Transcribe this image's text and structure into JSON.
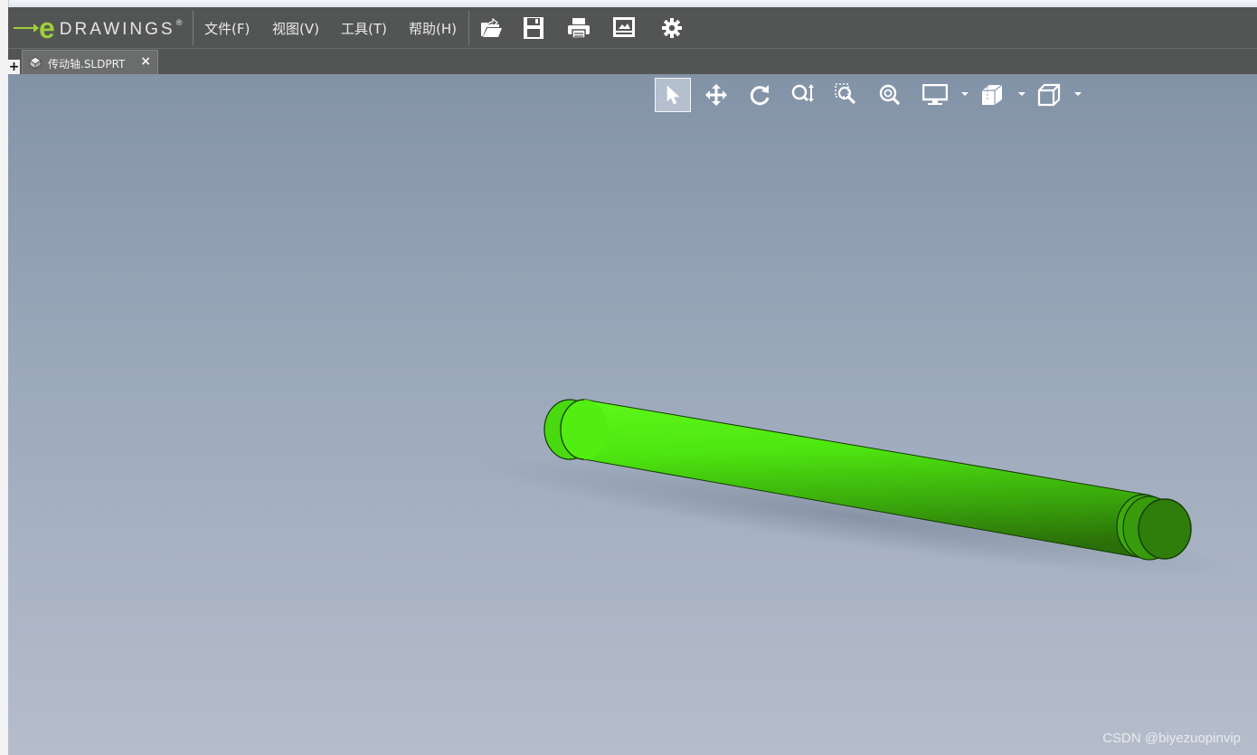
{
  "app": {
    "logo_letter": "e",
    "logo_text": "DRAWINGS",
    "logo_reg": "®",
    "accent_color": "#9ccf3a"
  },
  "menu": [
    {
      "label": "文件(F)"
    },
    {
      "label": "视图(V)"
    },
    {
      "label": "工具(T)"
    },
    {
      "label": "帮助(H)"
    }
  ],
  "toolbar": {
    "icons": [
      "open-icon",
      "save-icon",
      "print-icon",
      "publish-icon",
      "settings-icon"
    ]
  },
  "tabs": {
    "new_tab_glyph": "+",
    "document": {
      "label": "传动轴.SLDPRT",
      "close_glyph": "×"
    }
  },
  "view_toolbar": {
    "icons": [
      "select-icon",
      "pan-icon",
      "rotate-icon",
      "zoom-icon",
      "zoom-to-area-icon",
      "zoom-to-fit-icon",
      "display-style-icon",
      "sectioning-icon",
      "view-orientation-icon"
    ],
    "active": "select-icon"
  },
  "model": {
    "color": "#52ee0f",
    "description": "shaft"
  },
  "watermark": "CSDN @biyezuopinvip"
}
